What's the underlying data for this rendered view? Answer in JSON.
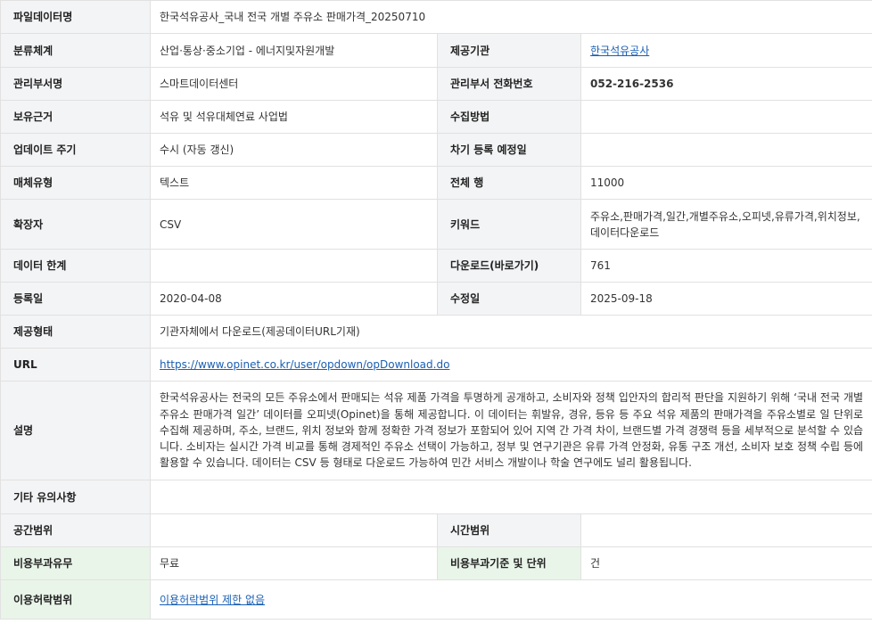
{
  "rows": {
    "file_name": {
      "label": "파일데이터명",
      "value": "한국석유공사_국내 전국 개별 주유소 판매가격_20250710"
    },
    "category": {
      "label": "분류체계",
      "value": "산업·통상·중소기업 - 에너지및자원개발",
      "label2": "제공기관",
      "value2": "한국석유공사"
    },
    "dept": {
      "label": "관리부서명",
      "value": "스마트데이터센터",
      "label2": "관리부서 전화번호",
      "value2": "052-216-2536"
    },
    "basis": {
      "label": "보유근거",
      "value": "석유 및 석유대체연료 사업법",
      "label2": "수집방법",
      "value2": ""
    },
    "update": {
      "label": "업데이트 주기",
      "value": "수시 (자동 갱신)",
      "label2": "차기 등록 예정일",
      "value2": ""
    },
    "media": {
      "label": "매체유형",
      "value": "텍스트",
      "label2": "전체 행",
      "value2": "11000"
    },
    "ext": {
      "label": "확장자",
      "value": "CSV",
      "label2": "키워드",
      "value2": "주유소,판매가격,일간,개별주유소,오피넷,유류가격,위치정보,데이터다운로드"
    },
    "limit": {
      "label": "데이터 한계",
      "value": "",
      "label2": "다운로드(바로가기)",
      "value2": "761"
    },
    "reg": {
      "label": "등록일",
      "value": "2020-04-08",
      "label2": "수정일",
      "value2": "2025-09-18"
    },
    "provide": {
      "label": "제공형태",
      "value": "기관자체에서 다운로드(제공데이터URL기재)"
    },
    "url": {
      "label": "URL",
      "value": "https://www.opinet.co.kr/user/opdown/opDownload.do"
    },
    "description": {
      "label": "설명",
      "value": "한국석유공사는 전국의 모든 주유소에서 판매되는 석유 제품 가격을 투명하게 공개하고, 소비자와 정책 입안자의 합리적 판단을 지원하기 위해 ‘국내 전국 개별 주유소 판매가격 일간’ 데이터를 오피넷(Opinet)을 통해 제공합니다. 이 데이터는 휘발유, 경유, 등유 등 주요 석유 제품의 판매가격을 주유소별로 일 단위로 수집해 제공하며, 주소, 브랜드, 위치 정보와 함께 정확한 가격 정보가 포함되어 있어 지역 간 가격 차이, 브랜드별 가격 경쟁력 등을 세부적으로 분석할 수 있습니다. 소비자는 실시간 가격 비교를 통해 경제적인 주유소 선택이 가능하고, 정부 및 연구기관은 유류 가격 안정화, 유통 구조 개선, 소비자 보호 정책 수립 등에 활용할 수 있습니다. 데이터는 CSV 등 형태로 다운로드 가능하여 민간 서비스 개발이나 학술 연구에도 널리 활용됩니다."
    },
    "notes": {
      "label": "기타 유의사항",
      "value": ""
    },
    "range": {
      "label": "공간범위",
      "value": "",
      "label2": "시간범위",
      "value2": ""
    },
    "fee": {
      "label": "비용부과유무",
      "value": "무료",
      "label2": "비용부과기준 및 단위",
      "value2": "건"
    },
    "license": {
      "label": "이용허락범위",
      "value": "이용허락범위 제한 없음"
    }
  }
}
